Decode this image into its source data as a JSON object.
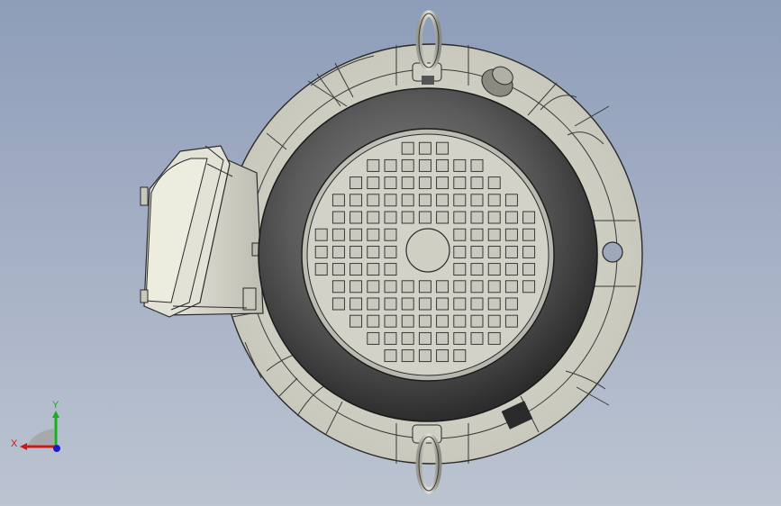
{
  "viewport": {
    "background_top": "#8e9db9",
    "background_bottom": "#bcc4d1"
  },
  "model": {
    "description_icon": "electric-motor-end-view",
    "body_color": "#d8d8cc",
    "housing_color": "#4a4a4a",
    "grille_color": "#c9c9c0"
  },
  "triad": {
    "x_label": "X",
    "y_label": "Y",
    "x_color": "#d01818",
    "y_color": "#18b018",
    "z_color": "#1a1ad0"
  }
}
